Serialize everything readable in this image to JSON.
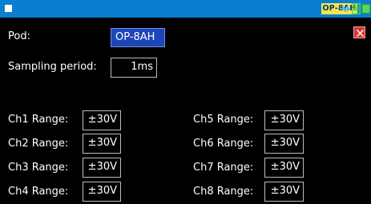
{
  "topbar": {
    "pod_badge": "OP-8AH",
    "icons": [
      "window-icon",
      "usb-icon",
      "sd-card-icon",
      "battery-icon"
    ],
    "colors": {
      "bar": "#0a7fd0",
      "badge": "#f7e44a",
      "badge_text": "#003a7a",
      "usb": "#4fc3f7",
      "sd": "#5bd45b",
      "battery": "#5bd45b"
    }
  },
  "close": {
    "icon": "close-icon",
    "color": "#d13a3a"
  },
  "pod": {
    "label": "Pod:",
    "value": "OP-8AH"
  },
  "sampling": {
    "label": "Sampling period:",
    "value": "1ms"
  },
  "channels": {
    "left": [
      {
        "label": "Ch1 Range:",
        "value": "±30V"
      },
      {
        "label": "Ch2 Range:",
        "value": "±30V"
      },
      {
        "label": "Ch3 Range:",
        "value": "±30V"
      },
      {
        "label": "Ch4 Range:",
        "value": "±30V"
      }
    ],
    "right": [
      {
        "label": "Ch5 Range:",
        "value": "±30V"
      },
      {
        "label": "Ch6 Range:",
        "value": "±30V"
      },
      {
        "label": "Ch7 Range:",
        "value": "±30V"
      },
      {
        "label": "Ch8 Range:",
        "value": "±30V"
      }
    ]
  }
}
